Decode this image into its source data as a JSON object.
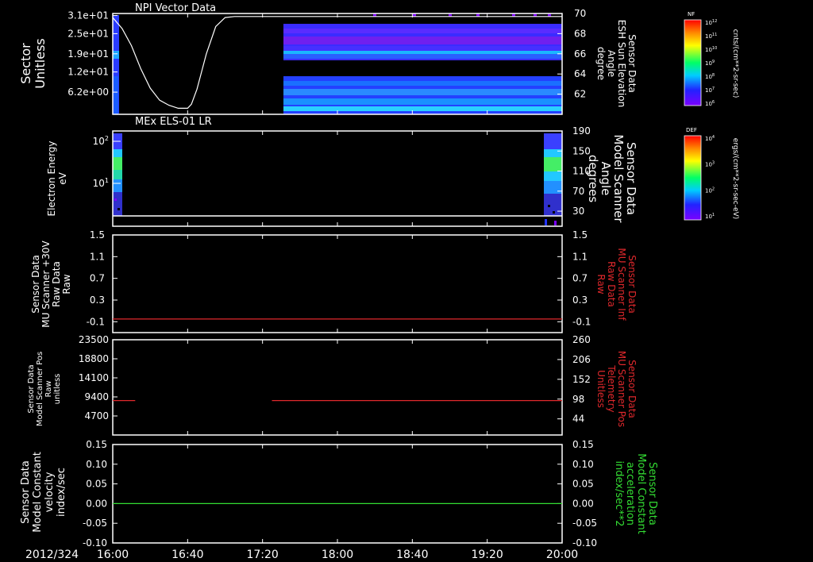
{
  "colors": {
    "background": "#000000",
    "frame": "#ffffff",
    "red": "#e0282c",
    "green": "#33dd33"
  },
  "date_label": "2012/324",
  "time_ticks": [
    "16:00",
    "16:40",
    "17:20",
    "18:00",
    "18:40",
    "19:20",
    "20:00"
  ],
  "colorbars": [
    {
      "title": "NF",
      "unit": "cnts/(cm**2-sr-sec)",
      "ticks": [
        "10^12",
        "10^11",
        "10^10",
        "10^9",
        "10^8",
        "10^7",
        "10^6"
      ]
    },
    {
      "title": "DEF",
      "unit": "ergs/(cm**2-sr-sec-eV)",
      "ticks": [
        "10^4",
        "10^3",
        "10^2",
        "10^1"
      ]
    }
  ],
  "chart_data": [
    {
      "type": "heatmap",
      "title": "NPI Vector Data",
      "ylabel_left": [
        "Sector",
        "Unitless"
      ],
      "yticks_left": [
        "3.1e+01",
        "2.5e+01",
        "1.9e+01",
        "1.2e+01",
        "6.2e+00"
      ],
      "ylabel_right": [
        "Sensor Data",
        "ESH Sun Elevation",
        "Angle",
        "degree"
      ],
      "yticks_right": [
        70,
        68,
        66,
        64,
        62
      ],
      "ylim_right": [
        60,
        70
      ],
      "line": {
        "x": [
          "16:00",
          "16:05",
          "16:10",
          "16:15",
          "16:20",
          "16:25",
          "16:30",
          "16:35",
          "16:40",
          "16:42",
          "16:45",
          "16:50",
          "16:55",
          "17:00",
          "17:05",
          "20:00"
        ],
        "y": [
          69.6,
          68.5,
          66.8,
          64.5,
          62.6,
          61.4,
          60.9,
          60.6,
          60.6,
          61.0,
          62.5,
          66.0,
          68.7,
          69.6,
          69.7,
          69.7
        ]
      }
    },
    {
      "type": "heatmap",
      "title": "MEx ELS-01 LR",
      "ylabel_left": [
        "Electron Energy",
        "eV"
      ],
      "yticks_left": [
        "10^2",
        "10^1"
      ],
      "ylabel_right": [
        "Sensor Data",
        "Model Scanner",
        "Angle",
        "degrees"
      ],
      "yticks_right": [
        190,
        150,
        110,
        70,
        30
      ],
      "ylim_right": [
        0,
        190
      ]
    },
    {
      "type": "line",
      "ylabel_left": [
        "Sensor Data",
        "MU Scanner +30V",
        "Raw Data",
        "Raw"
      ],
      "yticks": [
        "1.5",
        "1.1",
        "0.7",
        "0.3",
        "-0.1"
      ],
      "ylim": [
        -0.3,
        1.5
      ],
      "ylabel_right": [
        "Sensor Data",
        "MU Scanner Inf",
        "Raw Data",
        "Raw"
      ],
      "series": [
        {
          "color": "#e0282c",
          "x": [
            "16:00",
            "20:00"
          ],
          "y": [
            -0.05,
            -0.05
          ]
        }
      ]
    },
    {
      "type": "line",
      "ylabel_left": [
        "Sensor Data",
        "Model Scanner Pos",
        "Raw",
        "unitless"
      ],
      "yticks_left": [
        23500,
        18800,
        14100,
        9400,
        4700
      ],
      "ylim_left": [
        0,
        23500
      ],
      "ylabel_right": [
        "Sensor Data",
        "MU Scanner Pos",
        "Telemetry",
        "Unitless"
      ],
      "yticks_right": [
        260,
        206,
        152,
        98,
        44
      ],
      "ylim_right": [
        0,
        260
      ],
      "series": [
        {
          "color": "#e0282c",
          "x": [
            "16:00",
            "16:12"
          ],
          "y": [
            8500,
            8500
          ]
        },
        {
          "color": "#e0282c",
          "x": [
            "17:25",
            "20:00"
          ],
          "y": [
            8500,
            8500
          ]
        }
      ]
    },
    {
      "type": "line",
      "ylabel_left": [
        "Sensor Data",
        "Model Constant",
        "velocity",
        "index/sec"
      ],
      "yticks": [
        "0.15",
        "0.10",
        "0.05",
        "0.00",
        "-0.05",
        "-0.10"
      ],
      "ylim": [
        -0.1,
        0.15
      ],
      "ylabel_right": [
        "Sensor Data",
        "Model Constant",
        "acceleration",
        "index/sec**2"
      ],
      "series": [
        {
          "color": "#33dd33",
          "x": [
            "16:00",
            "20:00"
          ],
          "y": [
            0,
            0
          ]
        }
      ]
    }
  ]
}
